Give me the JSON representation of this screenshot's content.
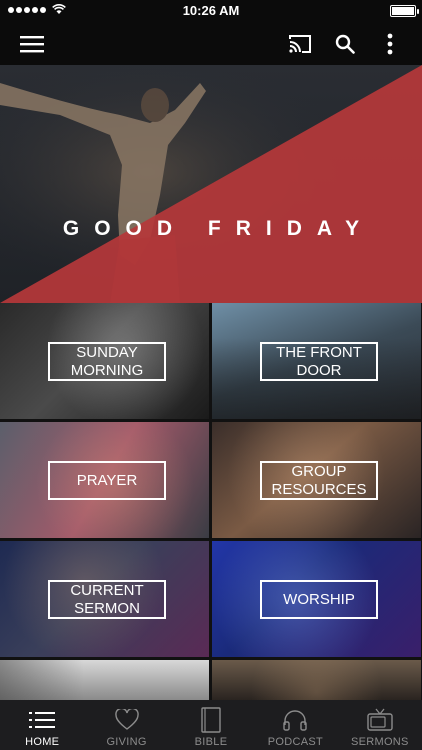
{
  "status": {
    "time": "10:26 AM"
  },
  "colors": {
    "accent_red": "#b5383a",
    "bar_bg": "#0b0b0b",
    "tab_bg": "#1d1d1f"
  },
  "toolbar": {
    "menu_icon": "hamburger-menu-icon",
    "cast_icon": "cast-icon",
    "search_icon": "search-icon",
    "more_icon": "more-vertical-icon"
  },
  "hero": {
    "title": "GOOD FRIDAY",
    "pages": 3,
    "active_page": 1
  },
  "tiles": [
    {
      "label": "SUNDAY MORNING"
    },
    {
      "label": "THE FRONT DOOR"
    },
    {
      "label": "PRAYER"
    },
    {
      "label": "GROUP RESOURCES"
    },
    {
      "label": "CURRENT SERMON"
    },
    {
      "label": "WORSHIP"
    }
  ],
  "tabs": [
    {
      "label": "HOME",
      "icon": "list-icon",
      "active": true
    },
    {
      "label": "GIVING",
      "icon": "heart-icon",
      "active": false
    },
    {
      "label": "BIBLE",
      "icon": "book-icon",
      "active": false
    },
    {
      "label": "PODCAST",
      "icon": "headphones-icon",
      "active": false
    },
    {
      "label": "SERMONS",
      "icon": "tv-icon",
      "active": false
    }
  ]
}
